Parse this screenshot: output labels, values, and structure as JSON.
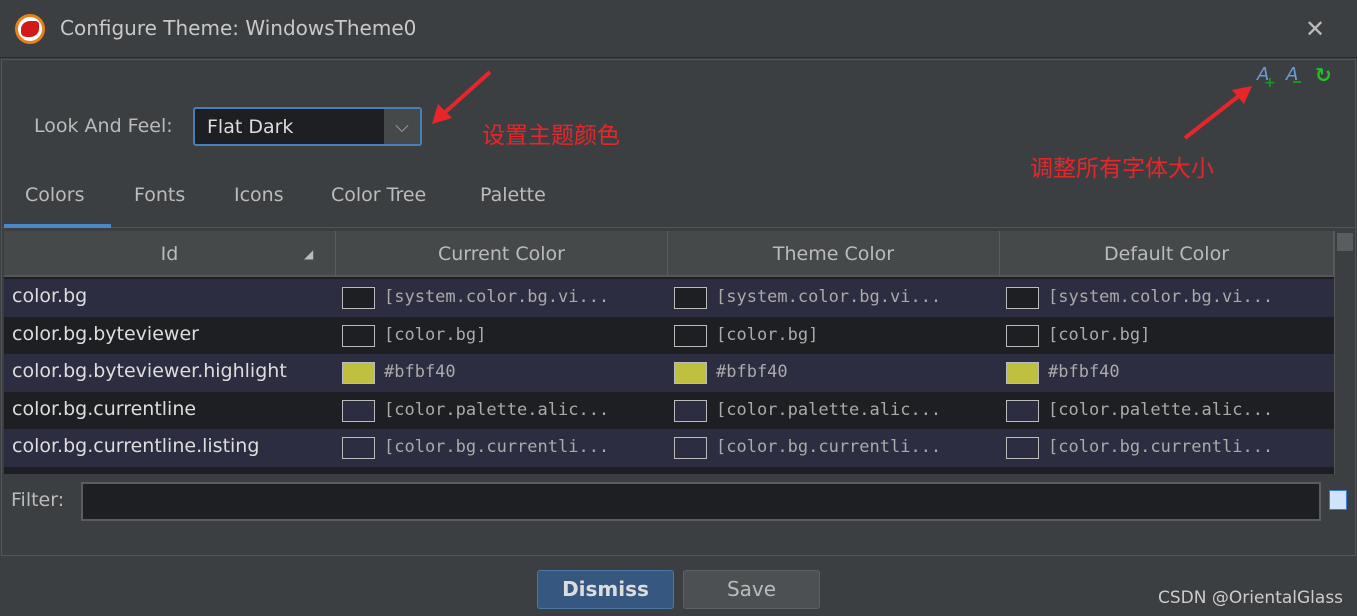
{
  "window": {
    "title": "Configure Theme: WindowsTheme0"
  },
  "look_and_feel": {
    "label": "Look And Feel:",
    "value": "Flat Dark"
  },
  "toolbar_icons": [
    "font-increase-icon",
    "font-decrease-icon",
    "reset-refresh-icon"
  ],
  "tabs": [
    {
      "label": "Colors",
      "selected": true
    },
    {
      "label": "Fonts"
    },
    {
      "label": "Icons"
    },
    {
      "label": "Color Tree"
    },
    {
      "label": "Palette"
    }
  ],
  "table": {
    "columns": [
      "Id",
      "Current Color",
      "Theme Color",
      "Default Color"
    ],
    "rows": [
      {
        "id": "color.bg",
        "value": "[system.color.bg.vi...",
        "swatch": "#1e1f22"
      },
      {
        "id": "color.bg.byteviewer",
        "value": "[color.bg]",
        "swatch": "#1e1f22"
      },
      {
        "id": "color.bg.byteviewer.highlight",
        "value": "#bfbf40",
        "swatch": "#bfbf40"
      },
      {
        "id": "color.bg.currentline",
        "value": "[color.palette.alic...",
        "swatch": "#2c2d40"
      },
      {
        "id": "color.bg.currentline.listing",
        "value": "[color.bg.currentli...",
        "swatch": "#2c2d40"
      }
    ]
  },
  "filter": {
    "label": "Filter:",
    "value": ""
  },
  "buttons": {
    "dismiss": "Dismiss",
    "save": "Save"
  },
  "annotations": {
    "theme_color": "设置主题颜色",
    "font_size": "调整所有字体大小"
  },
  "watermark": "CSDN @OrientalGlass",
  "colors": {
    "accent": "#4a88c7",
    "annotation": "#e8262a"
  }
}
